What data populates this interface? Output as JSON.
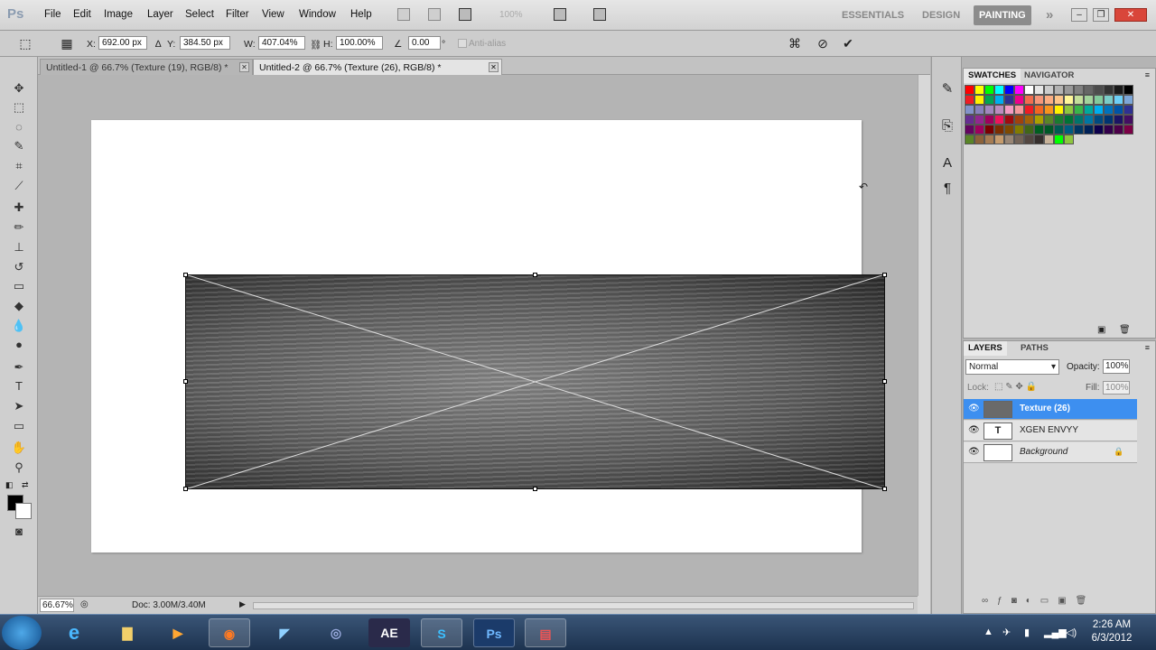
{
  "app": {
    "logo": "Ps"
  },
  "menu": [
    "File",
    "Edit",
    "Image",
    "Layer",
    "Select",
    "Filter",
    "View",
    "Window",
    "Help"
  ],
  "menubar_extra": {
    "zoom": "100%"
  },
  "workspaces": [
    "ESSENTIALS",
    "DESIGN",
    "PAINTING"
  ],
  "workspace_more": "»",
  "window_controls": {
    "minimize": "–",
    "restore": "❐",
    "close": "✕"
  },
  "options": {
    "x_label": "X:",
    "x_value": "692.00 px",
    "y_label": "Y:",
    "y_value": "384.50 px",
    "w_label": "W:",
    "w_value": "407.04%",
    "h_label": "H:",
    "h_value": "100.00%",
    "angle_value": "0.00",
    "angle_unit": "°",
    "antialias_label": "Anti-alias"
  },
  "tabs": [
    {
      "label": "Untitled-1 @ 66.7% (Texture (19), RGB/8) *",
      "active": false
    },
    {
      "label": "Untitled-2 @ 66.7% (Texture (26), RGB/8) *",
      "active": true
    }
  ],
  "tab_close": "✕",
  "status": {
    "zoom": "66.67%",
    "doc": "Doc: 3.00M/3.40M"
  },
  "swatches": {
    "tabs": [
      "SWATCHES",
      "NAVIGATOR"
    ],
    "colors": [
      "#ff0000",
      "#ffff00",
      "#00ff00",
      "#00ffff",
      "#0000ff",
      "#ff00ff",
      "#ffffff",
      "#e6e6e6",
      "#cccccc",
      "#b3b3b3",
      "#999999",
      "#808080",
      "#666666",
      "#4d4d4d",
      "#333333",
      "#1a1a1a",
      "#000000",
      "#ee1d24",
      "#fff200",
      "#00a651",
      "#00aeef",
      "#2e3192",
      "#ec008c",
      "#f26c4f",
      "#f69679",
      "#fbad82",
      "#fdc689",
      "#fff799",
      "#c4df9b",
      "#a2d39c",
      "#82ca9c",
      "#7accc8",
      "#6dcff6",
      "#7da7d9",
      "#8393ca",
      "#8781bd",
      "#a187be",
      "#bc8cbf",
      "#f49ac2",
      "#f5989d",
      "#ed1c24",
      "#f26522",
      "#f7941d",
      "#fff200",
      "#8dc63f",
      "#39b54a",
      "#00a99d",
      "#00aeef",
      "#0072bc",
      "#0054a6",
      "#2e3192",
      "#662d91",
      "#92278f",
      "#9e005d",
      "#ed145b",
      "#9e0b0f",
      "#a0410d",
      "#a36209",
      "#aba000",
      "#598527",
      "#197b30",
      "#007236",
      "#00746b",
      "#0076a3",
      "#004a80",
      "#003471",
      "#1b1464",
      "#440e62",
      "#630460",
      "#9e005d",
      "#790000",
      "#7b2e00",
      "#7d4900",
      "#827b00",
      "#406618",
      "#005e20",
      "#005826",
      "#005952",
      "#005b7f",
      "#003663",
      "#002157",
      "#0d004c",
      "#32004b",
      "#4b0049",
      "#7b0046",
      "#598527",
      "#8c6239",
      "#a67c52",
      "#c69c6d",
      "#998675",
      "#736357",
      "#534741",
      "#362f2d",
      "#c7b299",
      "#00ff00",
      "#8dc63f"
    ],
    "new_icon": "new-swatch-icon",
    "trash_icon": "trash-icon"
  },
  "layers": {
    "tabs": [
      "LAYERS",
      "PATHS"
    ],
    "blend_mode": "Normal",
    "opacity_label": "Opacity:",
    "opacity_value": "100%",
    "lock_label": "Lock:",
    "fill_label": "Fill:",
    "fill_value": "100%",
    "items": [
      {
        "name": "Texture (26)",
        "selected": true
      },
      {
        "name": "XGEN ENVYY",
        "selected": false,
        "thumb": "T"
      },
      {
        "name": "Background",
        "selected": false
      }
    ]
  },
  "taskbar": {
    "time": "2:26 AM",
    "date": "6/3/2012",
    "ae_label": "AE",
    "ps_label": "Ps"
  }
}
